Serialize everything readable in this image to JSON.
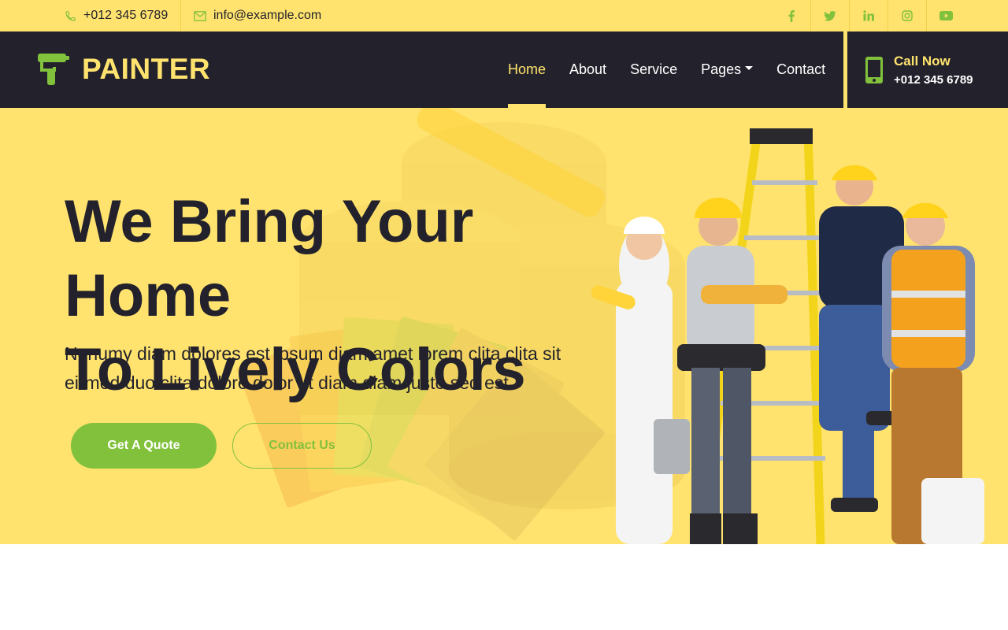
{
  "topbar": {
    "phone": "+012 345 6789",
    "email": "info@example.com",
    "social_icons": [
      "facebook-icon",
      "twitter-icon",
      "linkedin-icon",
      "instagram-icon",
      "youtube-icon"
    ]
  },
  "navbar": {
    "brand": "PAINTER",
    "items": [
      {
        "label": "Home",
        "active": true
      },
      {
        "label": "About"
      },
      {
        "label": "Service"
      },
      {
        "label": "Pages",
        "dropdown": true
      },
      {
        "label": "Contact"
      }
    ],
    "call": {
      "label": "Call Now",
      "number": "+012 345 6789"
    }
  },
  "hero": {
    "title_line1": "We Bring Your Home",
    "title_line2": "To Lively Colors",
    "subtitle_line1": "Nonumy diam dolores est ipsum diam amet lorem clita clita sit",
    "subtitle_line2": "eirmod duo clita dolore dolor ut diam diam justo sed est",
    "primary_button": "Get A Quote",
    "secondary_button": "Contact Us"
  },
  "colors": {
    "primary_yellow": "#ffe36e",
    "dark": "#23222c",
    "accent_green": "#81c13c"
  }
}
